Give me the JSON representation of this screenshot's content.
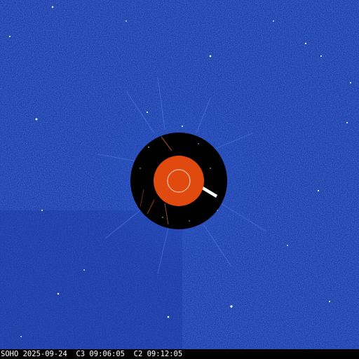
{
  "image": {
    "observatory": "SOHO",
    "date": "2025-09-24",
    "c3_time": "C3 09:06:05",
    "c2_time": "C2 09:12:05",
    "caption": "SOHO 2025-09-24  C3 09:06:05  C2 09:12:05"
  },
  "colors": {
    "corona_background": "#1f3fae",
    "occulter_disk": "#000000",
    "sun_disk": "#e04a0f",
    "sun_outline": "#f4dcc8",
    "star_points": "#ffffff",
    "caption_text": "#ffffff"
  },
  "icons": {
    "sun": "sun-disk-icon",
    "occulter": "occulter-disk-icon"
  }
}
